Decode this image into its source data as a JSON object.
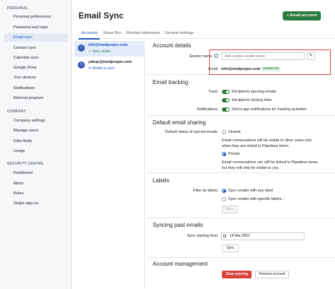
{
  "sidebar": {
    "sections": [
      {
        "title": "PERSONAL",
        "items": [
          "Personal preferences",
          "Password and login",
          "Email sync",
          "Contact sync",
          "Calendar sync",
          "Google Drive",
          "Your devices",
          "Notifications",
          "Referral program"
        ]
      },
      {
        "title": "COMPANY",
        "items": [
          "Company settings",
          "Manage users",
          "Data fields",
          "Usage"
        ]
      },
      {
        "title": "SECURITY CENTRE",
        "items": [
          "Dashboard",
          "Alerts",
          "Rules",
          "Single sign-on"
        ]
      }
    ],
    "active_item": "Email sync"
  },
  "header": {
    "title": "Email Sync",
    "add_button": "+ Email account"
  },
  "tabs": [
    "Accounts",
    "Smart Bcc",
    "Blocked addresses",
    "General settings"
  ],
  "active_tab": "Accounts",
  "accounts": [
    {
      "initial": "I",
      "email": "info@medproper.com",
      "status": "✓ Sync active"
    },
    {
      "initial": "Y",
      "email": "yakup@medproper.com",
      "status": "⟳ Ready to sync"
    }
  ],
  "account_details": {
    "title": "Account details",
    "sender_label": "Sender name",
    "sender_placeholder": "Add custom sender name",
    "email_label": "Email",
    "email_value": "info@medproper.com",
    "status_badge": "CONNECTED"
  },
  "email_tracking": {
    "title": "Email tracking",
    "track_label": "Track",
    "track_options": [
      "Recipients opening emails",
      "Recipients clicking links"
    ],
    "notifications_label": "Notifications",
    "notifications_option": "Get in-app notifications for tracking activities"
  },
  "sharing": {
    "title": "Default email sharing",
    "label": "Default status of synced emails",
    "shared_label": "Shared",
    "shared_desc_1": "Email conversations will be visible to other users only",
    "shared_desc_2": "when they are linked to Pipedrive items.",
    "private_label": "Private",
    "private_desc_1": "Email conversations can still be linked to Pipedrive items,",
    "private_desc_2": "but they will only be visible to you."
  },
  "labels": {
    "title": "Labels",
    "filter_label": "Filter by labels",
    "opt_any": "Sync emails with any label",
    "opt_specific": "Sync emails with specific labels...",
    "save": "Save"
  },
  "past_emails": {
    "title": "Syncing past emails",
    "label": "Sync starting from",
    "date": "14 Mar 2023",
    "sync": "Sync"
  },
  "management": {
    "title": "Account management",
    "stop": "Stop syncing",
    "remove": "Remove account"
  },
  "colors": {
    "accent": "#1b52c2",
    "green": "#2c7a3e",
    "danger": "#d9423a"
  }
}
